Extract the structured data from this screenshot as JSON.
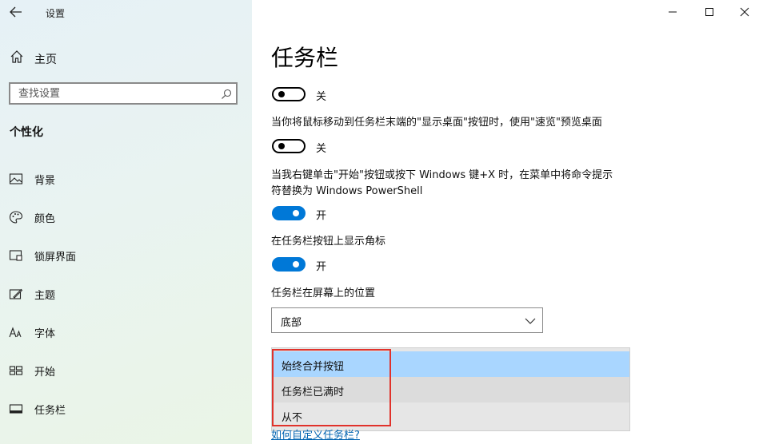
{
  "window": {
    "app_title": "设置",
    "controls": {
      "minimize": "minimize-icon",
      "maximize": "maximize-icon",
      "close": "close-icon"
    }
  },
  "sidebar": {
    "home_label": "主页",
    "search_placeholder": "查找设置",
    "section_title": "个性化",
    "items": [
      {
        "label": "背景",
        "icon": "picture-icon"
      },
      {
        "label": "颜色",
        "icon": "palette-icon"
      },
      {
        "label": "锁屏界面",
        "icon": "lock-screen-icon"
      },
      {
        "label": "主题",
        "icon": "theme-icon"
      },
      {
        "label": "字体",
        "icon": "font-icon"
      },
      {
        "label": "开始",
        "icon": "start-icon"
      },
      {
        "label": "任务栏",
        "icon": "taskbar-icon"
      }
    ]
  },
  "main": {
    "title": "任务栏",
    "settings": [
      {
        "description": "",
        "state": "off",
        "state_label": "关"
      },
      {
        "description": "当你将鼠标移动到任务栏末端的\"显示桌面\"按钮时，使用\"速览\"预览桌面",
        "state": "off",
        "state_label": "关"
      },
      {
        "description": "当我右键单击\"开始\"按钮或按下 Windows 键+X 时，在菜单中将命令提示符替换为 Windows PowerShell",
        "state": "on",
        "state_label": "开"
      },
      {
        "description": "在任务栏按钮上显示角标",
        "state": "on",
        "state_label": "开"
      }
    ],
    "position": {
      "label": "任务栏在屏幕上的位置",
      "value": "底部"
    },
    "combine_dropdown": {
      "options": [
        "始终合并按钮",
        "任务栏已满时",
        "从不"
      ],
      "selected_index": 0
    },
    "link_text": "如何自定义任务栏?"
  },
  "colors": {
    "accent": "#0078d7",
    "highlight_box": "#e0322b",
    "selected_option": "#a9d6ff"
  }
}
